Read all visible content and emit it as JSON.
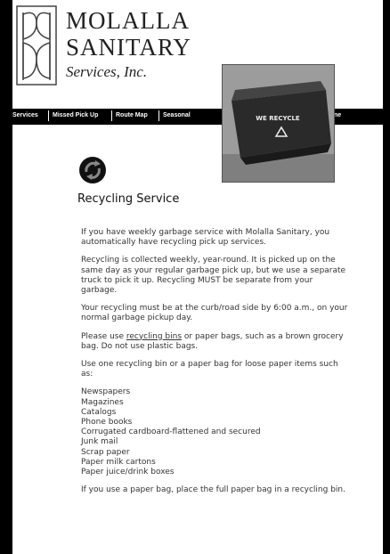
{
  "brand": {
    "line1": "MOLALLA",
    "line2": "SANITARY",
    "line3": "Services, Inc."
  },
  "nav": {
    "items": [
      "Services",
      "Missed Pick Up",
      "Route Map",
      "Seasonal",
      "ne"
    ]
  },
  "photo": {
    "label": "WE RECYCLE"
  },
  "page": {
    "title": "Recycling Service",
    "p1": "If you have weekly garbage service with Molalla Sanitary, you automatically have recycling pick up services.",
    "p2": "Recycling is collected weekly, year-round. It is picked up on the same day as your regular garbage pick up, but we use a separate truck to pick it up. Recycling MUST be separate from your garbage.",
    "p3": "Your recycling must be at the curb/road side by 6:00 a.m., on your normal garbage pickup day.",
    "p4_before": "Please use ",
    "p4_link": "recycling bins",
    "p4_after": " or paper bags, such as a brown grocery bag. Do not use plastic bags.",
    "p5": "Use one recycling bin or a paper bag for loose paper items such as:",
    "items": [
      "Newspapers",
      "Magazines",
      "Catalogs",
      "Phone books",
      "Corrugated cardboard-flattened and secured",
      "Junk mail",
      "Scrap paper",
      "Paper milk cartons",
      "Paper juice/drink boxes"
    ],
    "p6": "If you use a paper bag, place the full paper bag in a recycling bin."
  }
}
